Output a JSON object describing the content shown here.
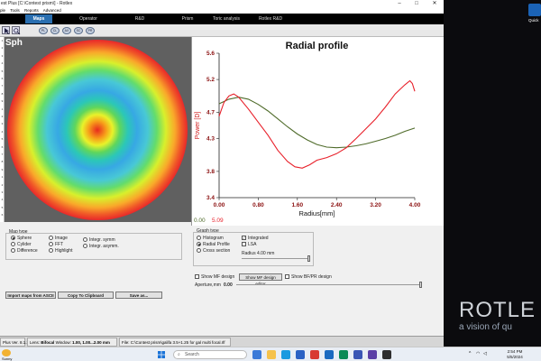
{
  "window": {
    "title": "est Plus [C:\\Contest prism\\] - Rotlex",
    "minimize": "–",
    "maximize": "□",
    "close": "✕"
  },
  "menu": [
    "ple",
    "Tools",
    "Reports",
    "Advanced"
  ],
  "tabs": [
    "Maps",
    "Operator",
    "R&D",
    "Prism",
    "Toric analysis",
    "Rotlex R&D"
  ],
  "toolbar_buttons": [
    "PL",
    "CL",
    "AX",
    "SC",
    "PR"
  ],
  "left_strip": [
    "1",
    "2",
    "3",
    "4",
    "5",
    "6",
    "7",
    "8",
    "9",
    "1",
    "2",
    "3",
    "4",
    "5",
    "6",
    "7",
    "8",
    "9",
    "1",
    "2",
    "3",
    "4",
    "5",
    "6"
  ],
  "map": {
    "label": "Sph"
  },
  "chart_data": {
    "type": "line",
    "title": "Radial profile",
    "xlabel": "Radius[mm]",
    "ylabel": "Power [D]",
    "xlim": [
      0,
      4
    ],
    "ylim": [
      3.4,
      5.6
    ],
    "xticks": [
      "0.00",
      "0.80",
      "1.60",
      "2.40",
      "3.20",
      "4.00"
    ],
    "xtick_values": [
      0,
      0.8,
      1.6,
      2.4,
      3.2,
      4.0
    ],
    "yticks": [
      "5.6",
      "5.2",
      "4.7",
      "4.3",
      "3.8",
      "3.4"
    ],
    "ytick_values": [
      5.6,
      5.2,
      4.7,
      4.3,
      3.8,
      3.4
    ],
    "grid": false,
    "series": [
      {
        "color": "#e8202a",
        "x": [
          0.0,
          0.1,
          0.2,
          0.3,
          0.4,
          0.6,
          0.8,
          1.0,
          1.2,
          1.4,
          1.55,
          1.7,
          1.85,
          2.0,
          2.2,
          2.4,
          2.6,
          2.8,
          3.0,
          3.2,
          3.4,
          3.6,
          3.8,
          3.9,
          3.95,
          4.0
        ],
        "y": [
          4.64,
          4.85,
          4.95,
          4.98,
          4.93,
          4.75,
          4.55,
          4.35,
          4.12,
          3.95,
          3.87,
          3.85,
          3.9,
          3.97,
          4.01,
          4.07,
          4.16,
          4.3,
          4.45,
          4.6,
          4.78,
          4.98,
          5.12,
          5.18,
          5.14,
          5.02
        ]
      },
      {
        "color": "#4f6b2a",
        "x": [
          0.0,
          0.2,
          0.4,
          0.6,
          0.8,
          1.0,
          1.2,
          1.4,
          1.6,
          1.8,
          2.0,
          2.2,
          2.4,
          2.6,
          2.8,
          3.0,
          3.2,
          3.4,
          3.6,
          3.8,
          4.0
        ],
        "y": [
          4.83,
          4.9,
          4.93,
          4.9,
          4.82,
          4.72,
          4.6,
          4.48,
          4.37,
          4.28,
          4.21,
          4.17,
          4.16,
          4.17,
          4.19,
          4.22,
          4.26,
          4.3,
          4.35,
          4.41,
          4.46
        ]
      }
    ],
    "corner_left": "0.00",
    "corner_right": "5.09"
  },
  "colors": {
    "chart_red": "#e8202a",
    "chart_green": "#4f6b2a",
    "tab_active": "#2a6fb0"
  },
  "map_type": {
    "title": "Map type",
    "col1": [
      {
        "label": "Sphere",
        "selected": true
      },
      {
        "label": "Cylider",
        "selected": false
      },
      {
        "label": "Difference",
        "selected": false
      }
    ],
    "col2": [
      {
        "label": "Image",
        "selected": false
      },
      {
        "label": "FFT",
        "selected": false
      },
      {
        "label": "Highlight",
        "selected": false
      }
    ],
    "col3": [
      {
        "label": "Integr. symm",
        "selected": false
      },
      {
        "label": "Integr. asymm.",
        "selected": false
      }
    ]
  },
  "graph_type": {
    "title": "Graph type",
    "options": [
      {
        "label": "Histogram",
        "selected": false
      },
      {
        "label": "Radial Profile",
        "selected": true
      },
      {
        "label": "Cross section",
        "selected": false
      }
    ],
    "integrated_label": "Integrated",
    "lsa_label": "LSA",
    "radius_label": "Radius 4.00 mm"
  },
  "mf_row": {
    "show_mf": "Show MF design",
    "show_mf_edit": "Show MF design editor",
    "show_bf": "Show BF/PR design",
    "aperture_label": "Aperture,mm",
    "aperture_value": "0.00"
  },
  "buttons": {
    "import": "Import maps from ASCII",
    "copy": "Copy To Clipboard",
    "save": "Save as..."
  },
  "status": {
    "version": "Plus Ver. 8.1.3",
    "lens_label": "Lens:",
    "lens_value": "Bifocal",
    "window_label": "Window:",
    "window_value": "1.00, 1.00...2.00 mm",
    "file_label": "File:",
    "file_value": "C:\\Contest prism\\galifa 3.5+1.25 for gal multi focal.rlf"
  },
  "taskbar": {
    "weather": "Sunny",
    "search_placeholder": "Search",
    "time": "2:54 PM",
    "date": "5/5/2024"
  },
  "desktop": {
    "logo": "ROTLE",
    "tagline": "a vision of qu",
    "icon_label": "Quick"
  }
}
